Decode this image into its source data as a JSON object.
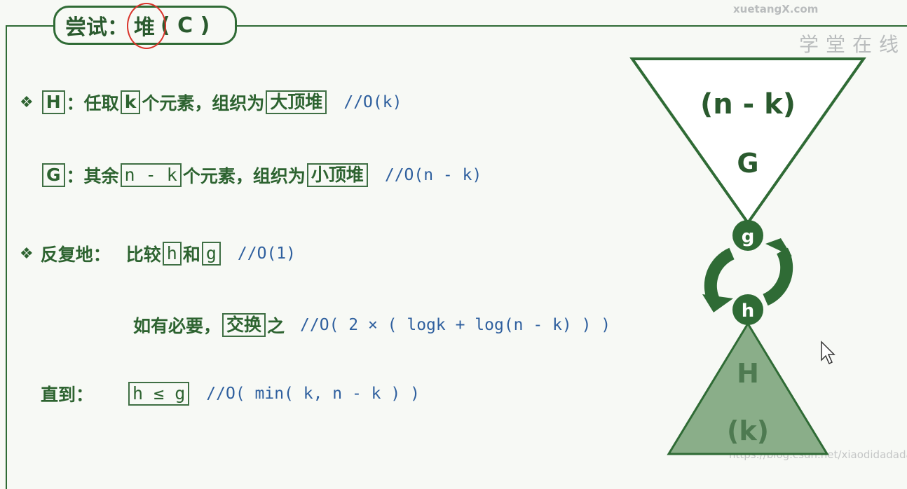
{
  "title": {
    "prefix": "尝试：",
    "circled": "堆",
    "suffix": "( C )"
  },
  "line1": {
    "bullet": "❖",
    "box1": "H",
    "t1": "：任取",
    "box2": "k",
    "t2": "个元素，组织为",
    "box3": "大顶堆",
    "comment": "//O(k)"
  },
  "line2": {
    "box1": "G",
    "t1": "：其余",
    "box2": "n - k",
    "t2": "个元素，组织为",
    "box3": "小顶堆",
    "comment": "//O(n - k)"
  },
  "line3": {
    "bullet": "❖",
    "t0": "反复地：",
    "t1": "比较",
    "box1": "h",
    "t2": "和",
    "box2": "g",
    "comment": "//O(1)"
  },
  "line4": {
    "t1": "如有必要，",
    "box1": "交换",
    "t2": "之",
    "comment": "//O( 2 × ( logk + log(n - k) ) )"
  },
  "line5": {
    "t1": "直到：",
    "box1": "h ≤ g",
    "comment": "//O( min( k, n - k ) )"
  },
  "diagram": {
    "top_label": "(n - k)",
    "top_letter": "G",
    "node_g": "g",
    "node_h": "h",
    "bottom_letter": "H",
    "bottom_label": "(k)",
    "colors": {
      "dark": "#2f6b35",
      "light": "#8aae89",
      "text": "#2a5a2e"
    }
  },
  "watermark": {
    "logo": "xuetangX.com",
    "sub": "学堂在线",
    "url": "https://blog.csdn.net/xiaodidadada"
  }
}
